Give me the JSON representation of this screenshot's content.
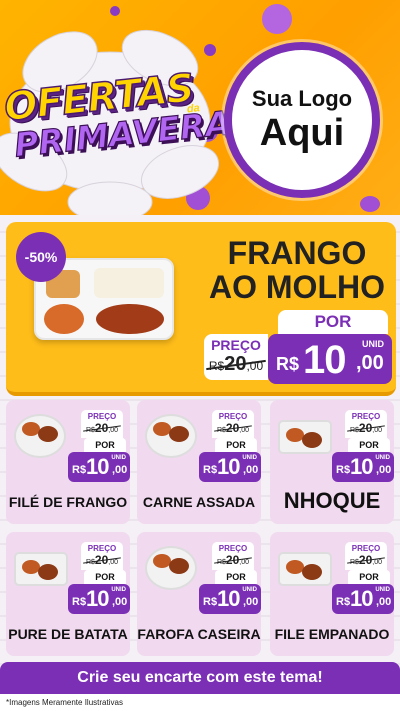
{
  "header": {
    "title_line1": "OFERTAS",
    "title_line2": "PRIMAVERA",
    "title_da": "da",
    "logo_small": "Sua Logo",
    "logo_big": "Aqui"
  },
  "hero": {
    "discount": "-50%",
    "name_line1": "FRANGO",
    "name_line2": "AO MOLHO",
    "preco_label": "PREÇO",
    "old_currency": "R$",
    "old_int": "20",
    "old_dec": ",00",
    "por_label": "POR",
    "unid_label": "UNID",
    "currency": "R$",
    "price_int": "10",
    "price_dec": ",00"
  },
  "products": [
    {
      "name": "FILÉ DE FRANGO",
      "preco_label": "PREÇO",
      "old_currency": "R$",
      "old_int": "20",
      "old_dec": ",00",
      "por_label": "POR",
      "unid_label": "UNID",
      "currency": "R$",
      "price_int": "10",
      "price_dec": ",00"
    },
    {
      "name": "CARNE ASSADA",
      "preco_label": "PREÇO",
      "old_currency": "R$",
      "old_int": "20",
      "old_dec": ",00",
      "por_label": "POR",
      "unid_label": "UNID",
      "currency": "R$",
      "price_int": "10",
      "price_dec": ",00"
    },
    {
      "name": "NHOQUE",
      "preco_label": "PREÇO",
      "old_currency": "R$",
      "old_int": "20",
      "old_dec": ",00",
      "por_label": "POR",
      "unid_label": "UNID",
      "currency": "R$",
      "price_int": "10",
      "price_dec": ",00"
    },
    {
      "name": "PURE DE BATATA",
      "preco_label": "PREÇO",
      "old_currency": "R$",
      "old_int": "20",
      "old_dec": ",00",
      "por_label": "POR",
      "unid_label": "UNID",
      "currency": "R$",
      "price_int": "10",
      "price_dec": ",00"
    },
    {
      "name": "FAROFA CASEIRA",
      "preco_label": "PREÇO",
      "old_currency": "R$",
      "old_int": "20",
      "old_dec": ",00",
      "por_label": "POR",
      "unid_label": "UNID",
      "currency": "R$",
      "price_int": "10",
      "price_dec": ",00"
    },
    {
      "name": "FILE EMPANADO",
      "preco_label": "PREÇO",
      "old_currency": "R$",
      "old_int": "20",
      "old_dec": ",00",
      "por_label": "POR",
      "unid_label": "UNID",
      "currency": "R$",
      "price_int": "10",
      "price_dec": ",00"
    }
  ],
  "cta": "Crie seu encarte com este tema!",
  "footnote": "*Imagens Meramente Ilustrativas",
  "colors": {
    "purple": "#7b2fb5",
    "orange": "#ffbd1a",
    "card_pink": "#f1d9ef"
  }
}
